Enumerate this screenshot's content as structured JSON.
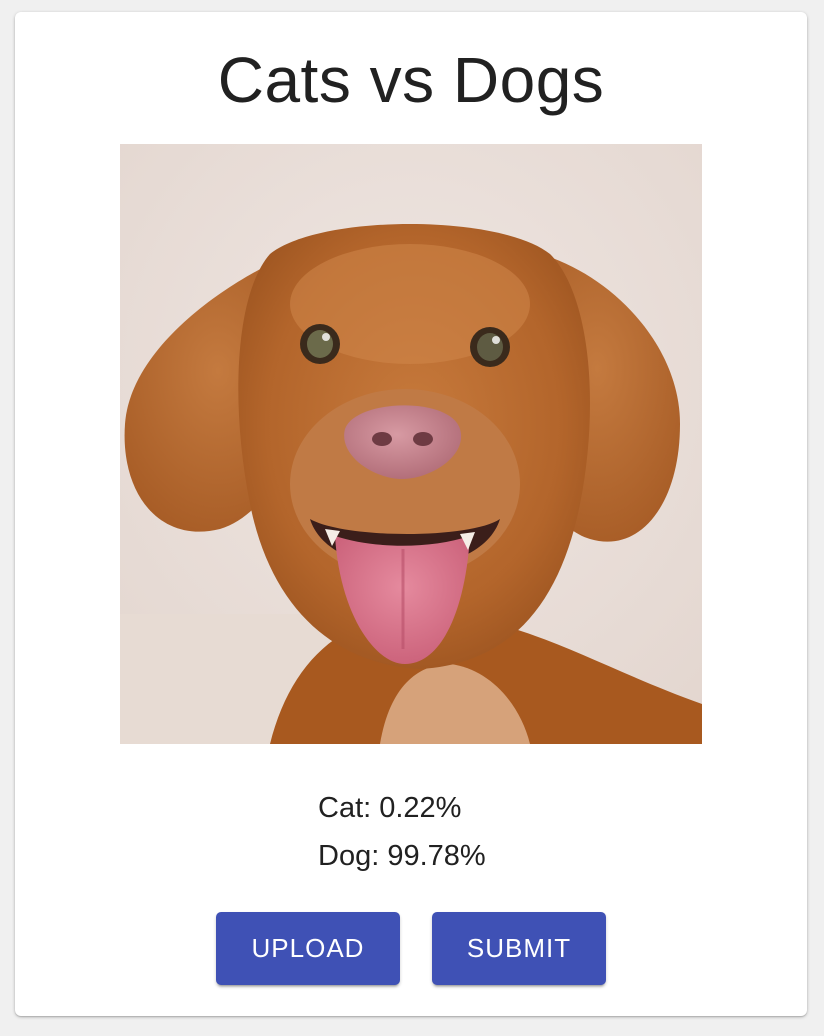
{
  "app": {
    "title": "Cats vs Dogs"
  },
  "image": {
    "subject": "dog-photo"
  },
  "results": {
    "cat_label": "Cat: 0.22%",
    "dog_label": "Dog: 99.78%"
  },
  "buttons": {
    "upload_label": "UPLOAD",
    "submit_label": "SUBMIT"
  },
  "colors": {
    "primary": "#3f51b5",
    "text": "#212121",
    "card_bg": "#ffffff",
    "page_bg": "#f0f0f0"
  }
}
